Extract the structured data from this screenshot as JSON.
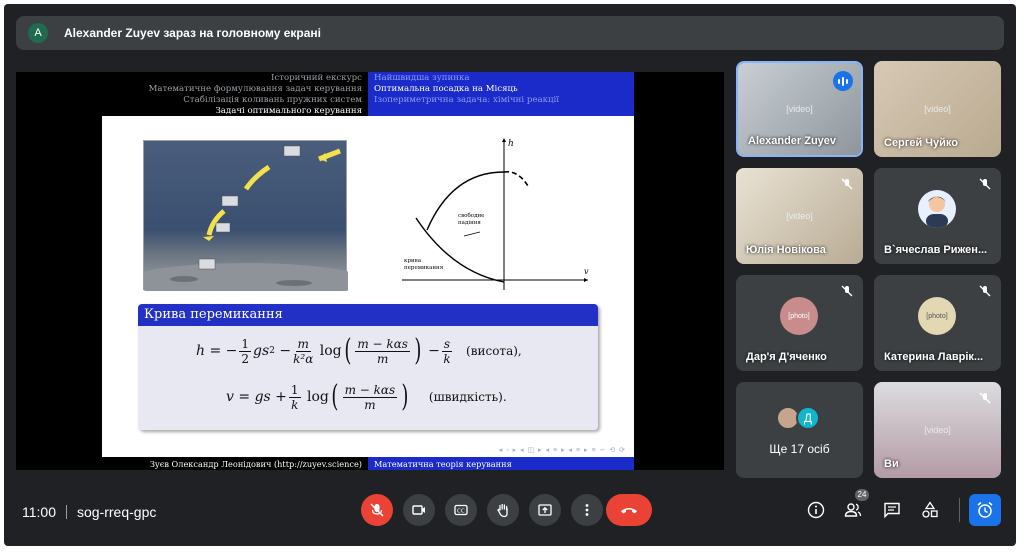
{
  "banner": {
    "avatar_letter": "A",
    "text": "Alexander Zuyev зараз на головному екрані"
  },
  "slide": {
    "header_left": [
      "Історичний екскурс",
      "Математичне формулювання задач керування",
      "Стабілізація коливань пружних систем",
      "Задачі оптимального керування"
    ],
    "header_right": [
      "Найшвидша зупинка",
      "Оптимальна посадка на Місяць",
      "Ізопериметрична задача: хімічні реакції"
    ],
    "footer_left": "Зуєв Олександр Леонідович (http://zuyev.science)",
    "footer_right": "Математична теорія керування",
    "graph_labels": {
      "h": "h",
      "v": "v",
      "free_fall_1": "свободне",
      "free_fall_2": "падіння",
      "switch_1": "крива",
      "switch_2": "перемикання"
    },
    "block_title": "Крива перемикання",
    "eq1_label": "(висота),",
    "eq2_label": "(швидкість).",
    "nav_icons": "◂ ▫ ▸ ◂ ◫ ▸ ◂ ≡ ▸ ◂ ≡ ▸ ≡ ∽ ⟲ ⟳"
  },
  "participants": [
    {
      "name": "Alexander Zuyev",
      "state": "speaking"
    },
    {
      "name": "Сергей Чуйко",
      "state": "normal"
    },
    {
      "name": "Юлія Новікова",
      "state": "muted"
    },
    {
      "name": "В`ячеслав Риженко",
      "display": "В`ячеслав Рижен...",
      "state": "muted"
    },
    {
      "name": "Дар'я Д'яченко",
      "state": "muted"
    },
    {
      "name": "Катерина Лаврік",
      "display": "Катерина Лаврік...",
      "state": "muted"
    },
    {
      "name": "Ще 17 осіб",
      "state": "group",
      "avatar_letter": "Д"
    },
    {
      "name": "Ви",
      "state": "muted"
    }
  ],
  "bottom": {
    "time": "11:00",
    "meeting_code": "sog-rreq-gpc",
    "people_count": "24"
  },
  "colors": {
    "accent": "#1a73e8",
    "danger": "#ea4335",
    "beamer_blue": "#1a2bc9"
  }
}
